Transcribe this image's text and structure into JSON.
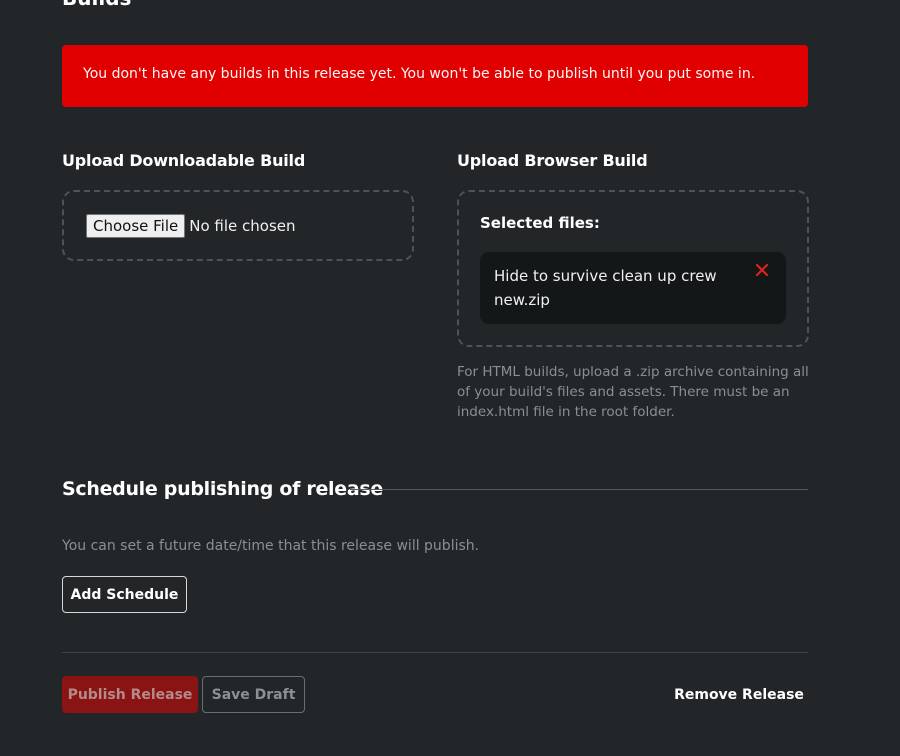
{
  "builds": {
    "title": "Builds",
    "alert_text": "You don't have any builds in this release yet. You won't be able to publish until you put some in."
  },
  "downloadable": {
    "heading": "Upload Downloadable Build",
    "choose_file_label": "Choose File",
    "no_file_text": "No file chosen"
  },
  "browser": {
    "heading": "Upload Browser Build",
    "selected_label": "Selected files:",
    "file_name": "Hide to survive clean up crew new.zip",
    "remove_icon": "close-icon",
    "help_text": "For HTML builds, upload a .zip archive containing all of your build's files and assets. There must be an index.html file in the root folder."
  },
  "schedule": {
    "title": "Schedule publishing of release",
    "description": "You can set a future date/time that this release will publish.",
    "add_button": "Add Schedule"
  },
  "actions": {
    "publish": "Publish Release",
    "save_draft": "Save Draft",
    "remove": "Remove Release"
  },
  "colors": {
    "background": "#232628",
    "alert": "#e00000",
    "accent_red": "#8a1414",
    "remove_x": "#e02020"
  }
}
